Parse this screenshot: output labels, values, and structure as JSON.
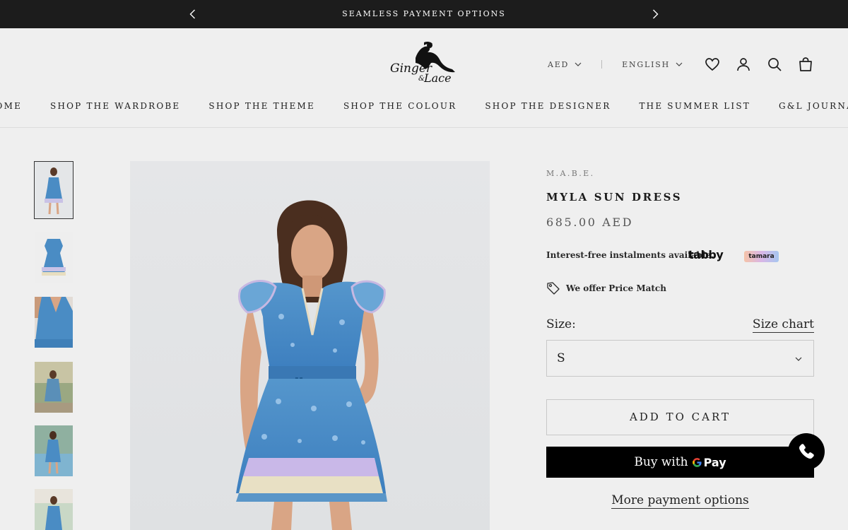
{
  "announcement": {
    "message": "SEAMLESS PAYMENT OPTIONS"
  },
  "header": {
    "logo_text": "Ginger & Lace",
    "currency": "AED",
    "language": "ENGLISH"
  },
  "nav": {
    "items": [
      {
        "label": "HOME"
      },
      {
        "label": "SHOP THE WARDROBE"
      },
      {
        "label": "SHOP THE THEME"
      },
      {
        "label": "SHOP THE COLOUR"
      },
      {
        "label": "SHOP THE DESIGNER"
      },
      {
        "label": "THE SUMMER LIST"
      },
      {
        "label": "G&L JOURNAL"
      }
    ]
  },
  "gallery": {
    "thumbnail_count": 6,
    "active_index": 0
  },
  "product": {
    "vendor": "M.A.B.E.",
    "title": "MYLA SUN DRESS",
    "price": "685.00 AED",
    "installments_text": "Interest-free instalments available.",
    "tabby_label": "tabby",
    "tamara_label": "tamara",
    "price_match_text": "We offer Price Match",
    "size_label": "Size:",
    "size_chart_label": "Size chart",
    "size_value": "S",
    "add_to_cart_label": "ADD TO CART",
    "gpay_buy_with": "Buy with",
    "gpay_pay": "Pay",
    "more_payment_label": "More payment options"
  },
  "colors": {
    "announcement_bg": "#1c1c1c",
    "page_bg": "#efefef",
    "gpay_bg": "#000000",
    "dress_blue": "#4a8cc4"
  },
  "icons": {
    "prev": "chevron-left-icon",
    "next": "chevron-right-icon",
    "wishlist": "heart-icon",
    "account": "user-icon",
    "search": "search-icon",
    "cart": "bag-icon",
    "price_match": "tag-icon",
    "call": "phone-icon"
  }
}
